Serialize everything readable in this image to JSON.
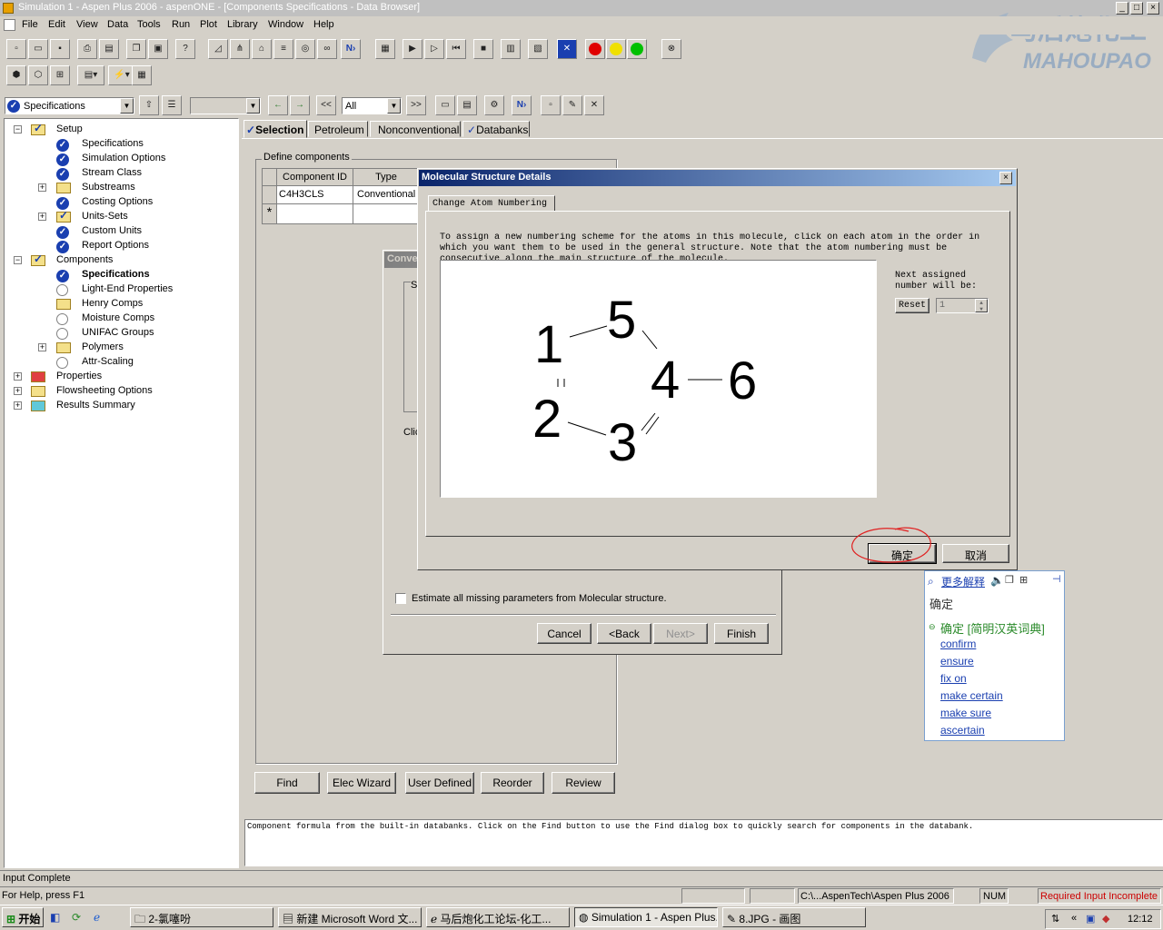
{
  "window": {
    "title": "Simulation 1 - Aspen Plus 2006 - aspenONE - [Components Specifications - Data Browser]"
  },
  "watermark": {
    "cn": "马后炮化工",
    "en": "MAHOUPAO"
  },
  "menu": [
    "File",
    "Edit",
    "View",
    "Data",
    "Tools",
    "Run",
    "Plot",
    "Library",
    "Window",
    "Help"
  ],
  "navbar": {
    "form_select": "Specifications",
    "filter_select": "All",
    "prev": "<<",
    "next": ">>"
  },
  "tree": [
    {
      "label": "Setup",
      "level": 0,
      "icon": "check"
    },
    {
      "label": "Specifications",
      "level": 1,
      "icon": "blue-check"
    },
    {
      "label": "Simulation Options",
      "level": 1,
      "icon": "blue-check"
    },
    {
      "label": "Stream Class",
      "level": 1,
      "icon": "blue-check"
    },
    {
      "label": "Substreams",
      "level": 1,
      "icon": "folder"
    },
    {
      "label": "Costing Options",
      "level": 1,
      "icon": "blue-check"
    },
    {
      "label": "Units-Sets",
      "level": 1,
      "icon": "check"
    },
    {
      "label": "Custom Units",
      "level": 1,
      "icon": "blue-check"
    },
    {
      "label": "Report Options",
      "level": 1,
      "icon": "blue-check"
    },
    {
      "label": "Components",
      "level": 0,
      "icon": "check"
    },
    {
      "label": "Specifications",
      "level": 1,
      "icon": "blue-check",
      "bold": true
    },
    {
      "label": "Light-End Properties",
      "level": 1,
      "icon": "circle"
    },
    {
      "label": "Henry Comps",
      "level": 1,
      "icon": "folder"
    },
    {
      "label": "Moisture Comps",
      "level": 1,
      "icon": "circle"
    },
    {
      "label": "UNIFAC Groups",
      "level": 1,
      "icon": "circle"
    },
    {
      "label": "Polymers",
      "level": 1,
      "icon": "folder"
    },
    {
      "label": "Attr-Scaling",
      "level": 1,
      "icon": "circle"
    },
    {
      "label": "Properties",
      "level": 0,
      "icon": "folder-red"
    },
    {
      "label": "Flowsheeting Options",
      "level": 0,
      "icon": "folder"
    },
    {
      "label": "Results Summary",
      "level": 0,
      "icon": "folder-cyan"
    }
  ],
  "tabs": [
    "Selection",
    "Petroleum",
    "Nonconventional",
    "Databanks"
  ],
  "define": {
    "group_label": "Define components",
    "col_id": "Component ID",
    "col_type": "Type",
    "row_id": "C4H3CLS",
    "row_type": "Conventional",
    "new_row_marker": "*"
  },
  "bottom_buttons": [
    "Find",
    "Elec Wizard",
    "User Defined",
    "Reorder",
    "Review"
  ],
  "prompt_text": "Component formula from the built-in databanks. Click on the Find button to use the Find dialog box to quickly search for components in the databank.",
  "wizard": {
    "title": "Conve",
    "s_label": "S",
    "click_label": "Clic",
    "estimate_label": "Estimate all missing parameters from Molecular structure.",
    "buttons": [
      "Cancel",
      "<Back",
      "Next>",
      "Finish"
    ]
  },
  "dialog": {
    "title": "Molecular Structure Details",
    "tab": "Change Atom Numbering",
    "instructions": "To assign a new numbering scheme for the atoms in this molecule, click on each atom in the order in which you want them to be used in the general structure. Note that the atom numbering must be consecutive along the main structure of the molecule.",
    "next_label": "Next assigned number will be:",
    "reset": "Reset",
    "next_value": "1",
    "ok": "确定",
    "cancel": "取消",
    "atoms": [
      "1",
      "2",
      "3",
      "4",
      "5",
      "6"
    ]
  },
  "dict_popup": {
    "more": "更多解释",
    "word": "确定",
    "source": "确定 [简明汉英词典]",
    "meanings": [
      "confirm",
      "ensure",
      "fix on",
      "make certain",
      "make sure",
      "ascertain"
    ]
  },
  "status": {
    "input": "Input Complete",
    "help": "For Help, press F1",
    "path": "C:\\...AspenTech\\Aspen Plus 2006",
    "num": "NUM",
    "required": "Required Input Incomplete",
    "required_color": "#cc0000"
  },
  "taskbar": {
    "start": "开始",
    "tasks": [
      "2-氯噻吩",
      "新建 Microsoft Word 文...",
      "马后炮化工论坛-化工...",
      "Simulation 1 - Aspen Plus...",
      "8.JPG - 画图"
    ],
    "clock": "12:12"
  }
}
